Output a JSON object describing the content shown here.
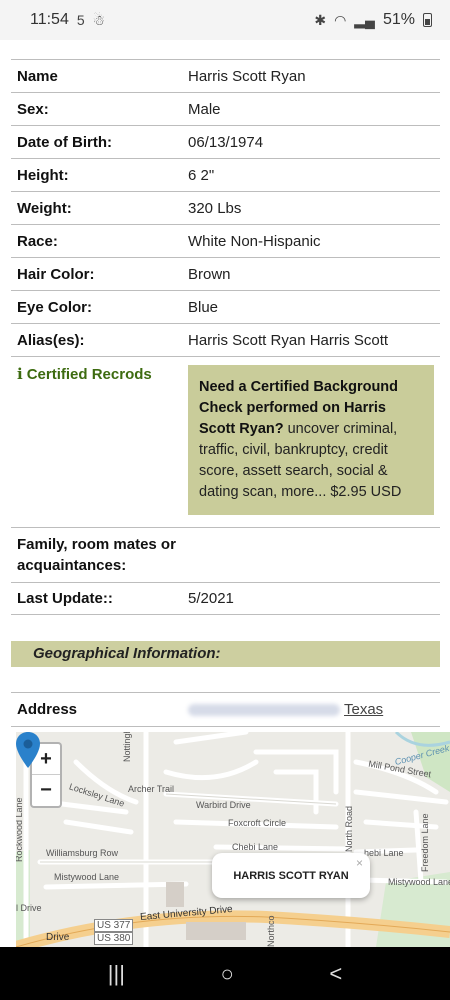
{
  "status": {
    "time": "11:54",
    "left_icons": "5",
    "battery": "51%"
  },
  "profile": {
    "rows": [
      {
        "label": "Name",
        "value": "Harris Scott Ryan"
      },
      {
        "label": "Sex:",
        "value": "Male"
      },
      {
        "label": "Date of Birth:",
        "value": "06/13/1974"
      },
      {
        "label": "Height:",
        "value": "6 2\""
      },
      {
        "label": "Weight:",
        "value": "320 Lbs"
      },
      {
        "label": "Race:",
        "value": "White Non-Hispanic"
      },
      {
        "label": "Hair Color:",
        "value": "Brown"
      },
      {
        "label": "Eye Color:",
        "value": "Blue"
      },
      {
        "label": "Alias(es):",
        "value": "Harris Scott Ryan Harris Scott"
      }
    ],
    "certified": {
      "label": "Certified Recrods",
      "heading": "Need a Certified Background Check performed on Harris Scott Ryan?",
      "body": " uncover criminal, traffic, civil, bankruptcy, credit score, assett search, social & dating scan, more... $2.95 USD"
    },
    "family_label": "Family, room mates or acquaintances:",
    "family_value": "",
    "last_update_label": "Last Update::",
    "last_update_value": "5/2021"
  },
  "geo": {
    "header": "Geographical Information:"
  },
  "address": {
    "label": "Address",
    "state": "Texas"
  },
  "map": {
    "zoom_in": "+",
    "zoom_out": "−",
    "popup": "HARRIS SCOTT RYAN",
    "popup_close": "×",
    "labels": {
      "archer": "Archer Trail",
      "warbird": "Warbird Drive",
      "foxcroft": "Foxcroft Circle",
      "chebi": "Chebi Lane",
      "chebi2": "hebi Lane",
      "williamsburg": "Williamsburg Row",
      "mistywood": "Mistywood Lane",
      "mistywood2": "Mistywood Lane",
      "east_univ": "East University Drive",
      "locksley": "Locksley Lane",
      "mill_pond": "Mill Pond Street",
      "cooper": "Cooper Creek",
      "us377": "US 377",
      "us380": "US 380",
      "drive": "Drive",
      "idrive": "l Drive",
      "nottingham": "Nottingham Dr",
      "rockwood": "Rockwood Lane",
      "north_road": "North Road",
      "freedom": "Freedom Lane",
      "northco": "Northco"
    }
  },
  "nav": {
    "recent": "|||",
    "home": "○",
    "back": "<"
  }
}
